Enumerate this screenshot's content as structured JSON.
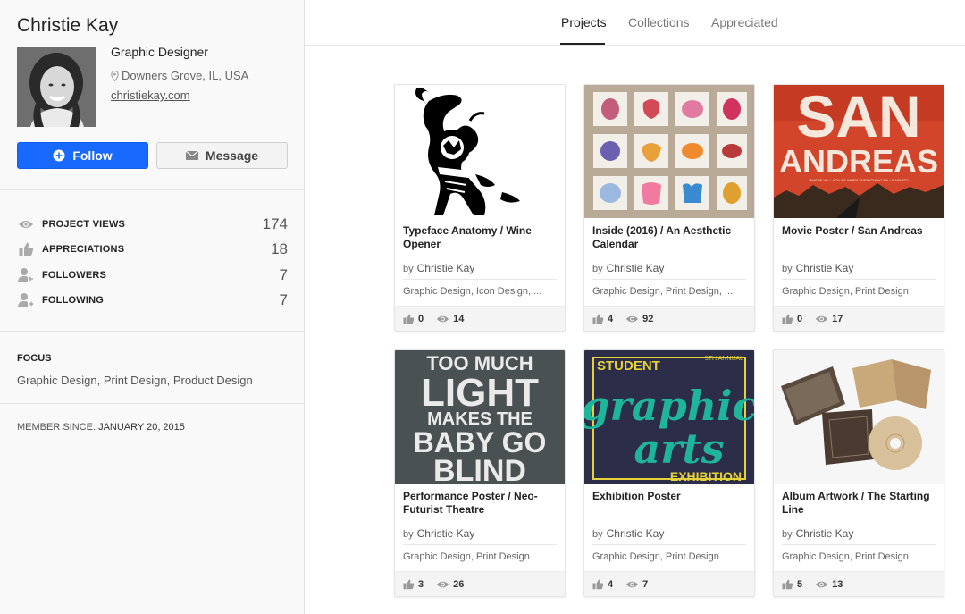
{
  "profile": {
    "name": "Christie Kay",
    "occupation": "Graphic Designer",
    "location": "Downers Grove, IL, USA",
    "website": "christiekay.com",
    "follow_label": "Follow",
    "message_label": "Message"
  },
  "stats": [
    {
      "label": "PROJECT VIEWS",
      "value": "174",
      "icon": "eye-icon"
    },
    {
      "label": "APPRECIATIONS",
      "value": "18",
      "icon": "thumbs-up-icon"
    },
    {
      "label": "FOLLOWERS",
      "value": "7",
      "icon": "followers-icon"
    },
    {
      "label": "FOLLOWING",
      "value": "7",
      "icon": "following-icon"
    }
  ],
  "focus": {
    "title": "FOCUS",
    "list": "Graphic Design, Print Design, Product Design"
  },
  "member": {
    "label": "MEMBER SINCE:",
    "date": "JANUARY 20, 2015"
  },
  "tabs": [
    {
      "label": "Projects",
      "active": true
    },
    {
      "label": "Collections",
      "active": false
    },
    {
      "label": "Appreciated",
      "active": false
    }
  ],
  "projects": [
    {
      "title": "Typeface Anatomy / Wine Opener",
      "by": "by",
      "author": "Christie Kay",
      "tags": "Graphic Design, Icon Design, ...",
      "appreciations": "0",
      "views": "14"
    },
    {
      "title": "Inside (2016) / An Aesthetic Calendar",
      "by": "by",
      "author": "Christie Kay",
      "tags": "Graphic Design, Print Design, ...",
      "appreciations": "4",
      "views": "92"
    },
    {
      "title": "Movie Poster / San Andreas",
      "by": "by",
      "author": "Christie Kay",
      "tags": "Graphic Design, Print Design",
      "appreciations": "0",
      "views": "17"
    },
    {
      "title": "Performance Poster / Neo-Futurist Theatre",
      "by": "by",
      "author": "Christie Kay",
      "tags": "Graphic Design, Print Design",
      "appreciations": "3",
      "views": "26"
    },
    {
      "title": "Exhibition Poster",
      "by": "by",
      "author": "Christie Kay",
      "tags": "Graphic Design, Print Design",
      "appreciations": "4",
      "views": "7"
    },
    {
      "title": "Album Artwork / The Starting Line",
      "by": "by",
      "author": "Christie Kay",
      "tags": "Graphic Design, Print Design",
      "appreciations": "5",
      "views": "13"
    }
  ],
  "thumb_text": {
    "san_andreas_1": "SAN",
    "san_andreas_2": "ANDREAS",
    "san_andreas_tag": "WHERE WILL YOU BE WHEN EVERYTHING FALLS APART?",
    "poster_1": "TOO MUCH",
    "poster_2": "LIGHT",
    "poster_3": "MAKES THE",
    "poster_4": "BABY GO",
    "poster_5": "BLIND",
    "exhibit_1": "STUDENT",
    "exhibit_2": "5TH ANNUAL",
    "exhibit_3": "graphic",
    "exhibit_4": "arts",
    "exhibit_5": "EXHIBITION"
  },
  "colors": {
    "follow": "#1769ff",
    "san_andreas_bg": "#d2452a",
    "poster_bg": "#4a5152",
    "exhibit_bg": "#2c2d48",
    "exhibit_accent": "#1fb59a",
    "exhibit_yellow": "#e5d23a"
  }
}
